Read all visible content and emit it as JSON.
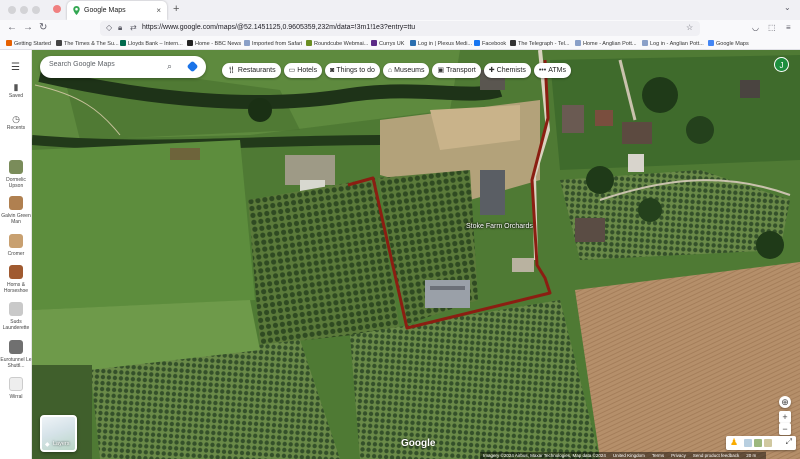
{
  "browser": {
    "tab_title": "Google Maps",
    "url": "https://www.google.com/maps/@52.1451125,0.9605359,232m/data=!3m1!1e3?entry=ttu",
    "bookmarks": [
      "Getting Started",
      "The Times & The Su...",
      "Lloyds Bank – Intern...",
      "Home - BBC News",
      "Imported from Safari",
      "Roundcube Webmai...",
      "Currys UK",
      "Log in | Plexus Medi...",
      "Facebook",
      "The Telegraph - Tel...",
      "Home - Anglian Pott...",
      "Log in - Anglian Pott...",
      "Google Maps"
    ]
  },
  "sidebar": {
    "menu_icon": "hamburger-icon",
    "saved_label": "Saved",
    "recents_label": "Recents",
    "recent_places": [
      {
        "label": "Dormelic Upson",
        "color": "#7a8c5a"
      },
      {
        "label": "Galvin Green Man",
        "color": "#b08050"
      },
      {
        "label": "Cromer",
        "color": "#c8a070"
      },
      {
        "label": "Horns & Horseshoe",
        "color": "#a05a30"
      },
      {
        "label": "Suds Launderette",
        "color": "#c9c9c9"
      },
      {
        "label": "Eurotunnel Le Shuttl...",
        "color": "#707070"
      },
      {
        "label": "Wirral",
        "color": "#eeeeee"
      }
    ]
  },
  "search": {
    "placeholder": "Search Google Maps"
  },
  "chips": [
    {
      "icon": "fork-knife-icon",
      "label": "Restaurants"
    },
    {
      "icon": "bed-icon",
      "label": "Hotels"
    },
    {
      "icon": "camera-icon",
      "label": "Things to do"
    },
    {
      "icon": "museum-icon",
      "label": "Museums"
    },
    {
      "icon": "bus-icon",
      "label": "Transport"
    },
    {
      "icon": "pharmacy-icon",
      "label": "Chemists"
    },
    {
      "icon": "more-icon",
      "label": "ATMs"
    }
  ],
  "account": {
    "initial": "J",
    "color": "#1e8e3e"
  },
  "map": {
    "place_label": "Stoke Farm Orchards",
    "logo": "Google",
    "layers_label": "Layers",
    "boundary_color": "#8b1e12"
  },
  "footer": {
    "attribution": "Imagery ©2024 Airbus, Maxar Technologies, Map data ©2024",
    "region": "United Kingdom",
    "terms": "Terms",
    "privacy": "Privacy",
    "feedback": "Send product feedback",
    "scale": "20 m"
  }
}
